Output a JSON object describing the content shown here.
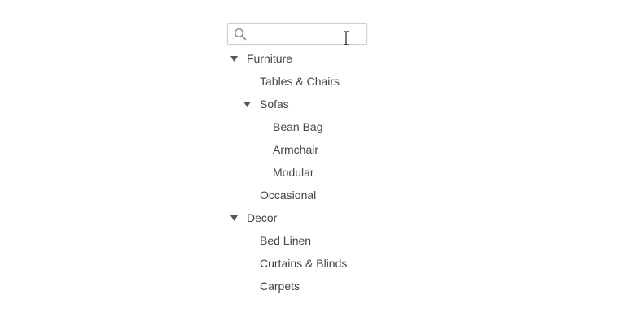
{
  "search": {
    "value": "",
    "placeholder": ""
  },
  "tree": [
    {
      "label": "Furniture",
      "level": 0,
      "expanded": true
    },
    {
      "label": "Tables & Chairs",
      "level": 1
    },
    {
      "label": "Sofas",
      "level": 1,
      "expanded": true
    },
    {
      "label": "Bean Bag",
      "level": 2
    },
    {
      "label": "Armchair",
      "level": 2
    },
    {
      "label": "Modular",
      "level": 2
    },
    {
      "label": "Occasional",
      "level": 1
    },
    {
      "label": "Decor",
      "level": 0,
      "expanded": true
    },
    {
      "label": "Bed Linen",
      "level": 1
    },
    {
      "label": "Curtains & Blinds",
      "level": 1
    },
    {
      "label": "Carpets",
      "level": 1
    }
  ],
  "icons": {
    "search": "search-icon",
    "expand": "caret-down-icon",
    "cursor": "text-cursor-icon"
  },
  "colors": {
    "text": "#444444",
    "border": "#cfcfcf",
    "caret": "#555555"
  }
}
